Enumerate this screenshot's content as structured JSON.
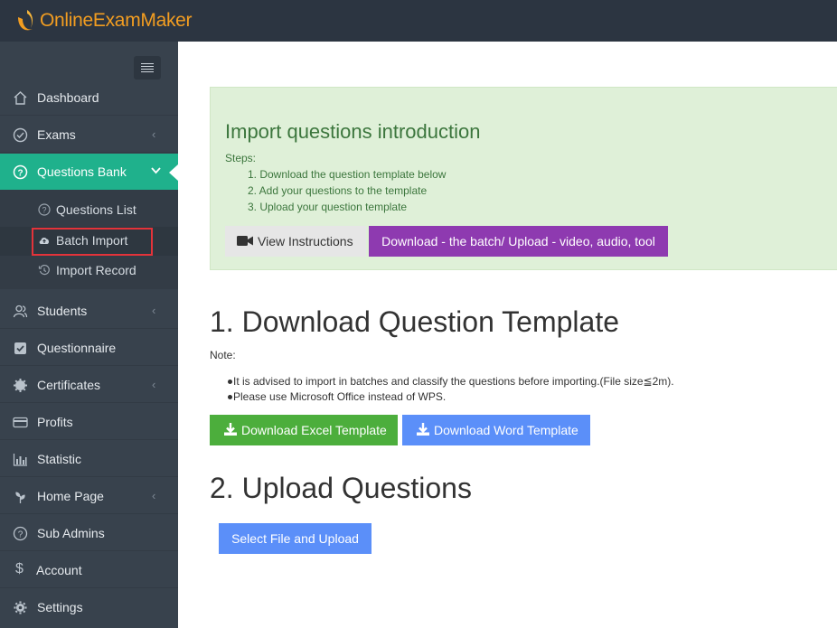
{
  "app": {
    "logo_text": "OnlineExamMaker"
  },
  "sidebar": {
    "items": [
      {
        "label": "Dashboard",
        "icon": "home-icon"
      },
      {
        "label": "Exams",
        "icon": "check-circle-icon",
        "chevron": "‹"
      },
      {
        "label": "Questions Bank",
        "icon": "question-circle-icon",
        "chevron": "⌄"
      },
      {
        "label": "Students",
        "icon": "users-icon",
        "chevron": "‹"
      },
      {
        "label": "Questionnaire",
        "icon": "checkbox-icon"
      },
      {
        "label": "Certificates",
        "icon": "gear-badge-icon",
        "chevron": "‹"
      },
      {
        "label": "Profits",
        "icon": "credit-card-icon"
      },
      {
        "label": "Statistic",
        "icon": "bar-chart-icon"
      },
      {
        "label": "Home Page",
        "icon": "leaf-icon",
        "chevron": "‹"
      },
      {
        "label": "Sub Admins",
        "icon": "question-circle-icon"
      },
      {
        "label": "Account",
        "icon": "dollar-icon"
      },
      {
        "label": "Settings",
        "icon": "gear-icon"
      }
    ],
    "subitems": [
      {
        "label": "Questions List",
        "icon": "question-circle-icon"
      },
      {
        "label": "Batch Import",
        "icon": "cloud-upload-icon"
      },
      {
        "label": "Import Record",
        "icon": "history-icon"
      }
    ]
  },
  "intro": {
    "title": "Import questions introduction",
    "steps_label": "Steps:",
    "steps": [
      "1. Download the question template below",
      "2. Add your questions to the template",
      "3. Upload your question template"
    ],
    "video_button": "View Instructions",
    "download_tool_button": "Download - the batch/ Upload - video, audio, tool"
  },
  "section1": {
    "title": "1. Download Question Template",
    "note_label": "Note:",
    "notes": [
      "It is advised to import in batches and classify the questions before importing.(File size≦2m).",
      "Please use Microsoft Office instead of WPS."
    ],
    "excel_button": "Download Excel Template",
    "word_button": "Download Word Template"
  },
  "section2": {
    "title": "2. Upload Questions",
    "upload_button": "Select File and Upload"
  },
  "colors": {
    "topbar": "#2c3541",
    "sidebar": "#38424d",
    "active": "#1fb18c",
    "intro_bg": "#dff0d8",
    "purple": "#8e3ab0",
    "green": "#4cae3c",
    "blue": "#5b8ff9",
    "logo": "#f29d21",
    "highlight": "#e3333a"
  }
}
